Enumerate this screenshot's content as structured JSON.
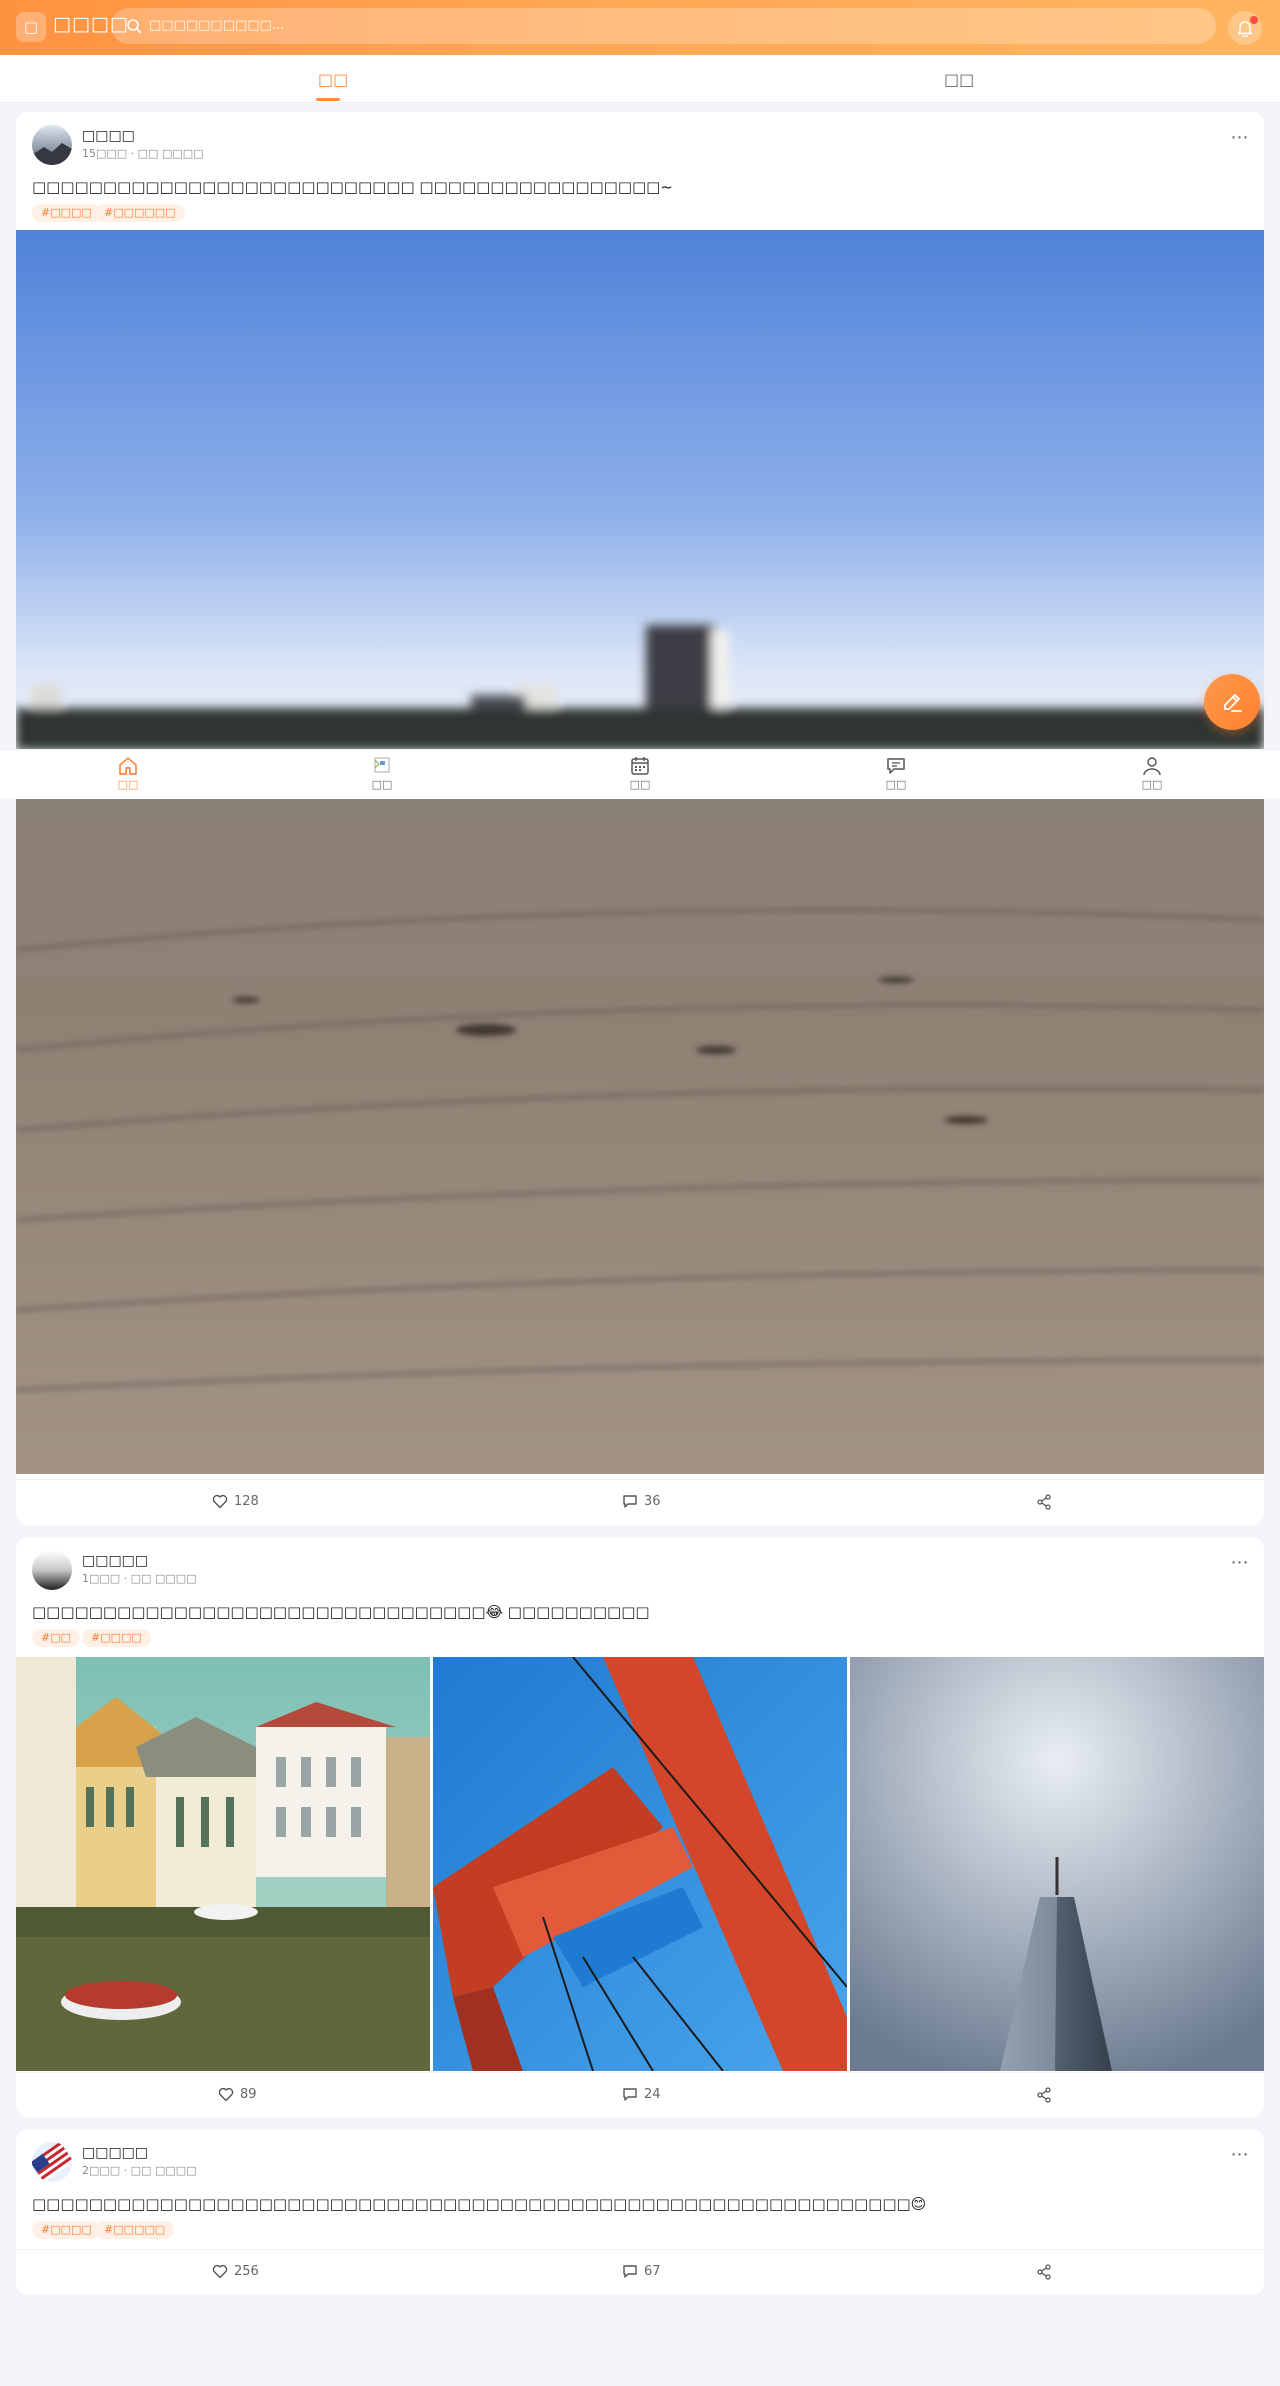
{
  "header": {
    "logo_icon": "▢",
    "app_name": "□□□□",
    "search_placeholder": "□□□□□□□□□□...",
    "notification_badge": true
  },
  "tabs": [
    {
      "label": "□□",
      "active": true
    },
    {
      "label": "□□",
      "active": false
    }
  ],
  "posts": [
    {
      "username": "□□□□",
      "meta": "15□□□ · □□ □□□□",
      "content": "□□□□□□□□□□□□□□□□□□□□□□□□□□□ □□□□□□□□□□□□□□□□□~",
      "tags": [
        "#□□□□",
        "#□□□□□□"
      ],
      "likes": "128",
      "comments": "36"
    },
    {
      "username": "□□□□□",
      "meta": "1□□□ · □□ □□□□",
      "content": "□□□□□□□□□□□□□□□□□□□□□□□□□□□□□□□□😂 □□□□□□□□□□",
      "tags": [
        "#□□",
        "#□□□□"
      ],
      "likes": "89",
      "comments": "24"
    },
    {
      "username": "□□□□□",
      "meta": "2□□□ · □□ □□□□",
      "content": "□□□□□□□□□□□□□□□□□□□□□□□□□□□□□□□□□□□□□□□□□□□□□□□□□□□□□□□□□□□□□□😊",
      "tags": [
        "#□□□□",
        "#□□□□□"
      ],
      "likes": "256",
      "comments": "67"
    }
  ],
  "bottom_nav": [
    {
      "label": "□□",
      "icon": "home-icon",
      "active": true
    },
    {
      "label": "□□",
      "icon": "broken-image-icon",
      "active": false
    },
    {
      "label": "□□",
      "icon": "calendar-icon",
      "active": false
    },
    {
      "label": "□□",
      "icon": "chat-icon",
      "active": false
    },
    {
      "label": "□□",
      "icon": "user-icon",
      "active": false
    }
  ],
  "colors": {
    "accent": "#ff8a3d",
    "tag_bg": "#fff0e6",
    "page_bg": "#f4f5fa"
  }
}
